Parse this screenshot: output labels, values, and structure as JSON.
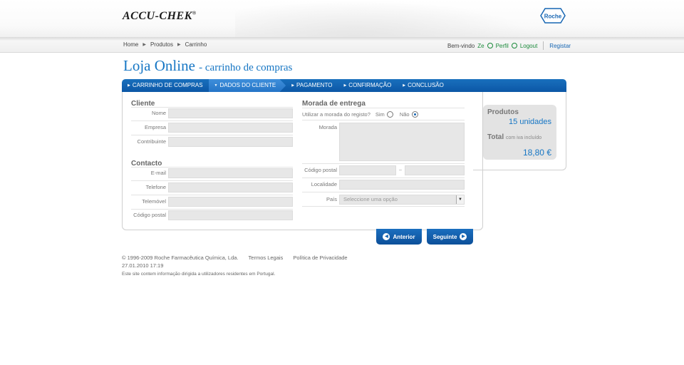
{
  "header": {
    "logo_text": "ACCU-CHEK",
    "logo_reg": "®",
    "roche_logo": "Roche"
  },
  "nav": {
    "breadcrumbs": [
      "Home",
      "Produtos",
      "Carrinho"
    ],
    "welcome": "Bem-vindo",
    "user": "Ze",
    "profile": "Perfil",
    "logout": "Logout",
    "register": "Registar"
  },
  "page": {
    "title": "Loja Online",
    "subtitle": "- carrinho de compras"
  },
  "steps": [
    {
      "label": "CARRINHO DE COMPRAS",
      "active": false
    },
    {
      "label": "DADOS DO CLIENTE",
      "active": true
    },
    {
      "label": "PAGAMENTO",
      "active": false
    },
    {
      "label": "CONFIRMAÇÃO",
      "active": false
    },
    {
      "label": "CONCLUSÃO",
      "active": false
    }
  ],
  "client": {
    "title": "Cliente",
    "fields": {
      "nome": {
        "label": "Nome",
        "value": ""
      },
      "empresa": {
        "label": "Empresa",
        "value": ""
      },
      "contribuinte": {
        "label": "Contribuinte",
        "value": ""
      }
    }
  },
  "contact": {
    "title": "Contacto",
    "fields": {
      "email": {
        "label": "E-mail",
        "value": ""
      },
      "telefone": {
        "label": "Telefone",
        "value": ""
      },
      "telemovel": {
        "label": "Telemóvel",
        "value": ""
      },
      "codigo_postal": {
        "label": "Código postal",
        "value": ""
      }
    }
  },
  "delivery": {
    "title": "Morada de entrega",
    "use_registered": "Utilizar a morada do registo?",
    "yes": "Sim",
    "no": "Não",
    "selected": "no",
    "morada_label": "Morada",
    "codigo_postal_label": "Código postal",
    "postal_sep": "–",
    "localidade_label": "Localidade",
    "pais_label": "País",
    "pais_placeholder": "Seleccione uma opção"
  },
  "summary": {
    "products_label": "Produtos",
    "products_value": "15 unidades",
    "total_label": "Total",
    "total_note": "com iva incluído",
    "total_value": "18,80 €"
  },
  "buttons": {
    "previous": "Anterior",
    "next": "Seguinte"
  },
  "footer": {
    "copyright": "© 1996-2009 Roche Farmacêutica Química, Lda.",
    "legal": "Termos Legais",
    "privacy": "Política de Privacidade",
    "date": "27.01.2010 17:19",
    "disclaimer": "Este site contem informação dirigida a utilizadores residentes em Portugal."
  },
  "colors": {
    "brand_blue": "#1676c4",
    "nav_blue": "#0c57a6",
    "green": "#1a8a3a"
  }
}
